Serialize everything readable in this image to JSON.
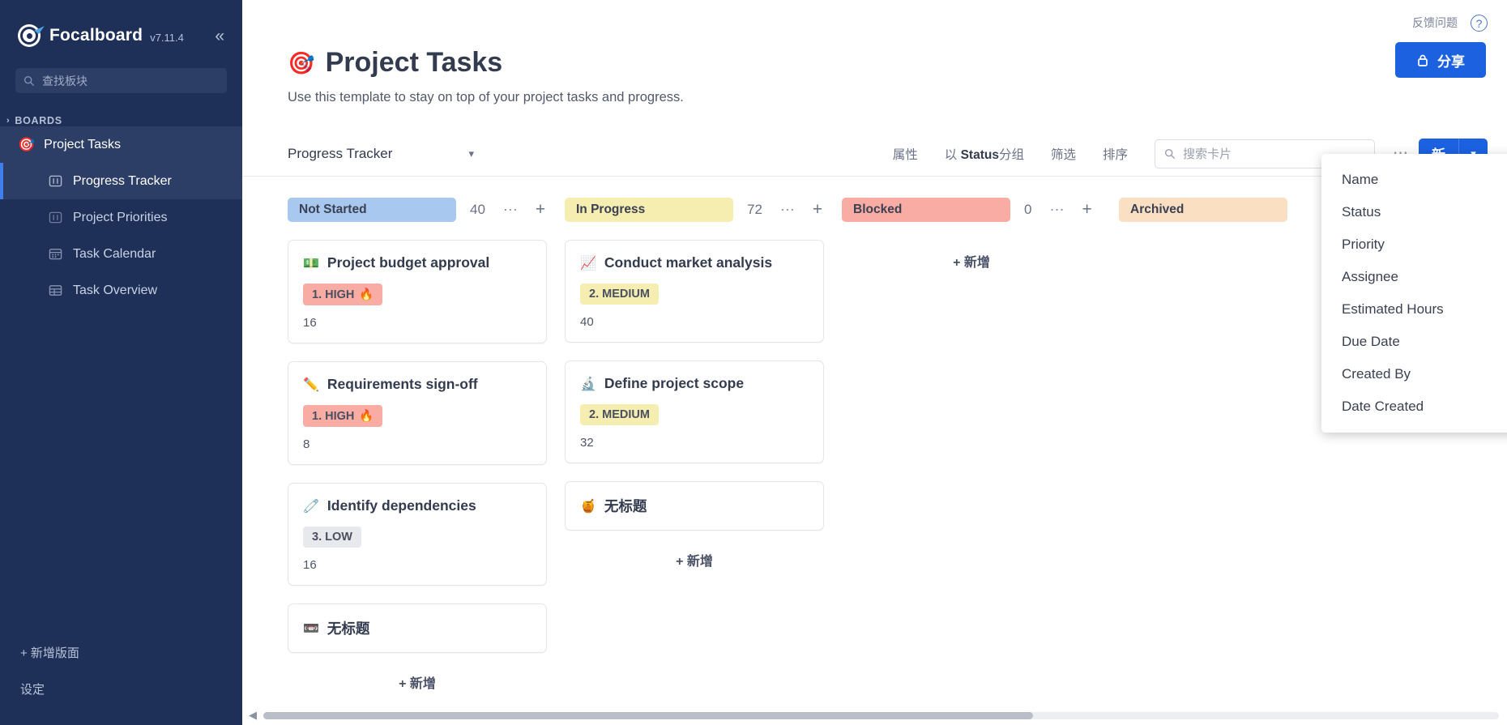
{
  "sidebar": {
    "product_name": "Focalboard",
    "version": "v7.11.4",
    "collapse_icon": "chevrons-left-icon",
    "search_placeholder": "查找板块",
    "boards_label": "BOARDS",
    "board_root": {
      "emoji": "🎯",
      "label": "Project Tasks"
    },
    "views": [
      {
        "label": "Progress Tracker",
        "icon": "board-view-icon",
        "active": true
      },
      {
        "label": "Project Priorities",
        "icon": "board-view-icon",
        "active": false
      },
      {
        "label": "Task Calendar",
        "icon": "calendar-view-icon",
        "active": false
      },
      {
        "label": "Task Overview",
        "icon": "table-view-icon",
        "active": false
      }
    ],
    "footer": [
      {
        "label": "+ 新增版面"
      },
      {
        "label": "设定"
      }
    ]
  },
  "topbar": {
    "feedback_label": "反馈问题",
    "help_icon": "question-mark-icon",
    "share_label": "分享",
    "share_icon": "lock-icon"
  },
  "page": {
    "emoji": "🎯",
    "title": "Project Tasks",
    "description": "Use this template to stay on top of your project tasks and progress."
  },
  "toolbar": {
    "view_name": "Progress Tracker",
    "view_caret": "chevron-down-icon",
    "properties_label": "属性",
    "group_by_prefix": "以 ",
    "group_by_field": "Status",
    "group_by_suffix": "分组",
    "filter_label": "筛选",
    "sort_label": "排序",
    "search_placeholder": "搜索卡片",
    "search_value": "",
    "more_icon": "ellipsis-icon",
    "new_label": "新",
    "new_caret": "chevron-down-icon"
  },
  "menu": {
    "items": [
      {
        "label": "Name"
      },
      {
        "label": "Status"
      },
      {
        "label": "Priority"
      },
      {
        "label": "Assignee"
      },
      {
        "label": "Estimated Hours"
      },
      {
        "label": "Due Date"
      },
      {
        "label": "Created By"
      },
      {
        "label": "Date Created"
      }
    ]
  },
  "board": {
    "add_label": "+ 新增",
    "columns": [
      {
        "name": "Not Started",
        "count": "40",
        "chip_color": "#a8c8ef",
        "cards": [
          {
            "emoji": "💵",
            "title": "Project budget approval",
            "badge": "1. HIGH",
            "badge_emoji": "🔥",
            "badge_color": "#f9aca4",
            "value": "16"
          },
          {
            "emoji": "✏️",
            "title": "Requirements sign-off",
            "badge": "1. HIGH",
            "badge_emoji": "🔥",
            "badge_color": "#f9aca4",
            "value": "8"
          },
          {
            "emoji": "🧷",
            "title": "Identify dependencies",
            "badge": "3. LOW",
            "badge_emoji": "",
            "badge_color": "#e8e9ec",
            "value": "16"
          },
          {
            "emoji": "📼",
            "title": "无标题",
            "badge": "",
            "badge_emoji": "",
            "badge_color": "",
            "value": ""
          }
        ]
      },
      {
        "name": "In Progress",
        "count": "72",
        "chip_color": "#f5eeb0",
        "cards": [
          {
            "emoji": "📈",
            "title": "Conduct market analysis",
            "badge": "2. MEDIUM",
            "badge_emoji": "",
            "badge_color": "#f5eeb0",
            "value": "40"
          },
          {
            "emoji": "🔬",
            "title": "Define project scope",
            "badge": "2. MEDIUM",
            "badge_emoji": "",
            "badge_color": "#f5eeb0",
            "value": "32"
          },
          {
            "emoji": "🍯",
            "title": "无标题",
            "badge": "",
            "badge_emoji": "",
            "badge_color": "",
            "value": ""
          }
        ]
      },
      {
        "name": "Blocked",
        "count": "0",
        "chip_color": "#f9aca4",
        "cards": []
      },
      {
        "name": "Archived",
        "count": "",
        "chip_color": "#fadfc3",
        "cards": []
      }
    ]
  },
  "scrollbar": {
    "left_arrow": "chevron-left-icon"
  }
}
